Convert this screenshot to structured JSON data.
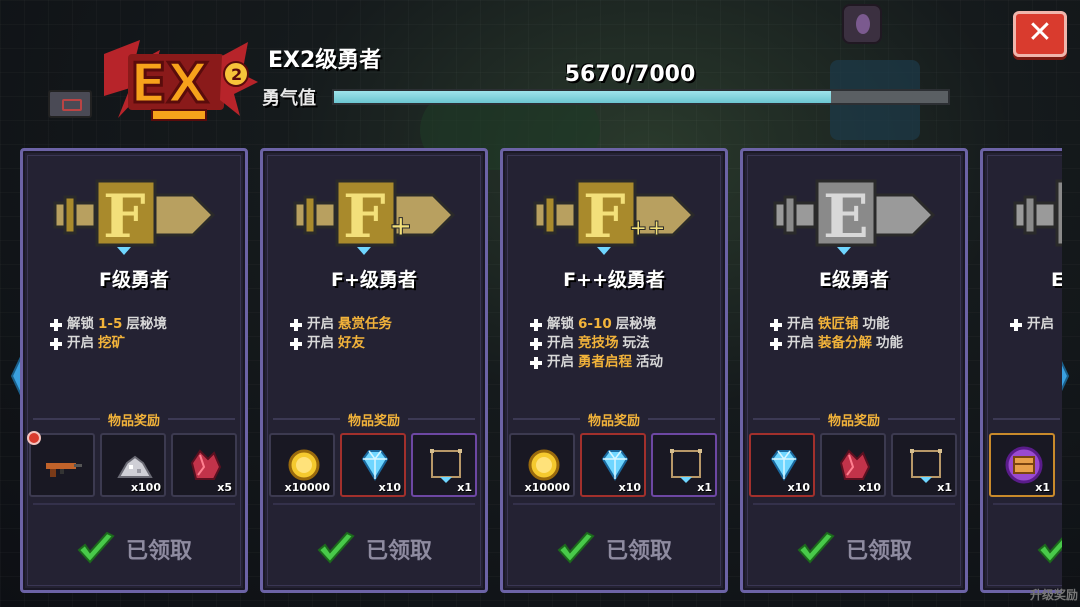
{
  "header": {
    "logo_text": "EX",
    "logo_level": "2",
    "rank_title": "EX2级勇者",
    "courage_label": "勇气值",
    "progress": {
      "current": 5670,
      "max": 7000,
      "text": "5670/7000"
    },
    "close_label": "✕"
  },
  "cards": [
    {
      "rank_letter": "F",
      "suffix": "",
      "name": "F级勇者",
      "perks": [
        [
          {
            "t": "解锁"
          },
          {
            "t": "1-5",
            "hl": true
          },
          {
            "t": "层秘境"
          }
        ],
        [
          {
            "t": "开启"
          },
          {
            "t": "挖矿",
            "hl": true
          }
        ]
      ],
      "reward_label": "物品奖励",
      "rewards": [
        {
          "icon": "rifle-icon",
          "qty": "",
          "frame": "plain",
          "badge": true
        },
        {
          "icon": "ore-pile-icon",
          "qty": "x100",
          "frame": "plain"
        },
        {
          "icon": "red-crystal-icon",
          "qty": "x5",
          "frame": "plain"
        }
      ],
      "status": "已领取"
    },
    {
      "rank_letter": "F",
      "suffix": "+",
      "name": "F+级勇者",
      "perks": [
        [
          {
            "t": "开启 "
          },
          {
            "t": "悬赏任务",
            "hl": true
          }
        ],
        [
          {
            "t": "开启 "
          },
          {
            "t": "好友",
            "hl": true
          }
        ]
      ],
      "reward_label": "物品奖励",
      "rewards": [
        {
          "icon": "gold-coin-icon",
          "qty": "x10000",
          "frame": "plain"
        },
        {
          "icon": "diamond-icon",
          "qty": "x10",
          "frame": "red"
        },
        {
          "icon": "frame-icon",
          "qty": "x1",
          "frame": "purple"
        }
      ],
      "status": "已领取"
    },
    {
      "rank_letter": "F",
      "suffix": "++",
      "name": "F++级勇者",
      "perks": [
        [
          {
            "t": "解锁"
          },
          {
            "t": "6-10",
            "hl": true
          },
          {
            "t": "层秘境"
          }
        ],
        [
          {
            "t": "开启"
          },
          {
            "t": "竞技场",
            "hl": true
          },
          {
            "t": "玩法"
          }
        ],
        [
          {
            "t": "开启"
          },
          {
            "t": "勇者启程",
            "hl": true
          },
          {
            "t": "活动"
          }
        ]
      ],
      "reward_label": "物品奖励",
      "rewards": [
        {
          "icon": "gold-coin-icon",
          "qty": "x10000",
          "frame": "plain"
        },
        {
          "icon": "diamond-icon",
          "qty": "x10",
          "frame": "red"
        },
        {
          "icon": "frame-icon",
          "qty": "x1",
          "frame": "purple"
        }
      ],
      "status": "已领取"
    },
    {
      "rank_letter": "E",
      "suffix": "",
      "name": "E级勇者",
      "perks": [
        [
          {
            "t": "开启 "
          },
          {
            "t": "铁匠铺",
            "hl": true
          },
          {
            "t": "功能"
          }
        ],
        [
          {
            "t": "开启"
          },
          {
            "t": "装备分解",
            "hl": true
          },
          {
            "t": "功能"
          }
        ]
      ],
      "reward_label": "物品奖励",
      "rewards": [
        {
          "icon": "diamond-icon",
          "qty": "x10",
          "frame": "red"
        },
        {
          "icon": "red-crystal-icon",
          "qty": "x10",
          "frame": "plain"
        },
        {
          "icon": "frame-icon",
          "qty": "x1",
          "frame": "plain"
        }
      ],
      "status": "已领取"
    },
    {
      "rank_letter": "E",
      "suffix": "+",
      "name": "E+级勇者",
      "perks": [
        [
          {
            "t": "开启"
          }
        ]
      ],
      "reward_label": "物品奖励",
      "rewards": [
        {
          "icon": "treasure-chest-icon",
          "qty": "x1",
          "frame": "orange"
        }
      ],
      "status": "已领取"
    }
  ],
  "nav": {
    "prev": "prev-page",
    "next": "next-page"
  },
  "bottom_hint": "升级奖励",
  "colors": {
    "accent": "#f2b33a",
    "card_border": "#6c63a6",
    "progress": "#6cc6d1",
    "close": "#d93b2e",
    "check": "#49c94a"
  }
}
